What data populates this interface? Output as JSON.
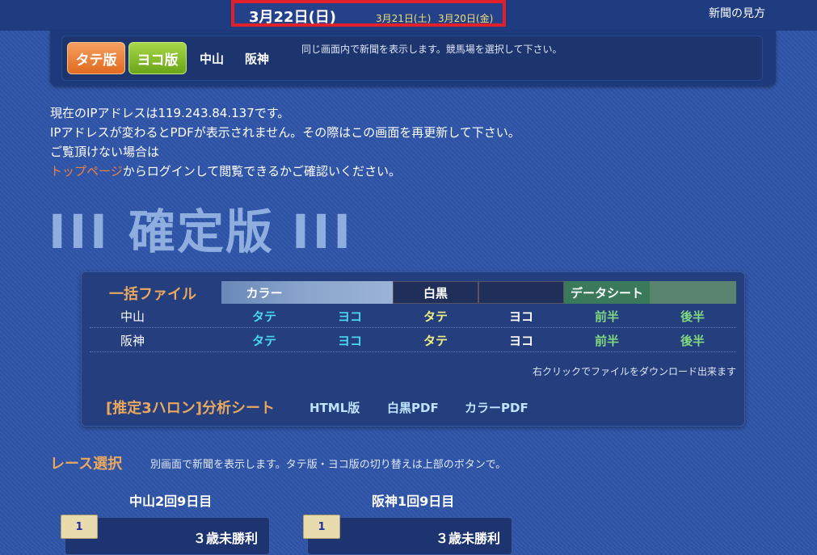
{
  "header": {
    "date_main": "3月22日(日)",
    "date_sat": "3月21日(土)",
    "date_fri": "3月20日(金)",
    "guide_link": "新聞の見方"
  },
  "panel": {
    "tate_button": "タテ版",
    "yoko_button": "ヨコ版",
    "course_nakayama": "中山",
    "course_hanshin": "阪神",
    "note": "同じ画面内で新聞を表示します。競馬場を選択して下さい。"
  },
  "messages": {
    "line1": "現在のIPアドレスは119.243.84.137です。",
    "line2": "IPアドレスが変わるとPDFが表示されません。その際はこの画面を再更新して下さい。",
    "line3": "ご覧頂けない場合は",
    "line4_link": "トップページ",
    "line4_rest": "からログインして閲覧できるかご確認いください。"
  },
  "title": {
    "bars": "III",
    "label": "確定版"
  },
  "bulk": {
    "title": "一括ファイル",
    "h_color": "カラー",
    "h_bw": "白黒",
    "h_data": "データシート",
    "rows": [
      {
        "name": "中山",
        "c1": "タテ",
        "c2": "ヨコ",
        "c3": "タテ",
        "c4": "ヨコ",
        "c5": "前半",
        "c6": "後半"
      },
      {
        "name": "阪神",
        "c1": "タテ",
        "c2": "ヨコ",
        "c3": "タテ",
        "c4": "ヨコ",
        "c5": "前半",
        "c6": "後半"
      }
    ],
    "rclick_note": "右クリックでファイルをダウンロード出来ます",
    "analysis_title": "[推定3ハロン]分析シート",
    "html_link": "HTML版",
    "bw_pdf": "白黒PDF",
    "color_pdf": "カラーPDF"
  },
  "race": {
    "title": "レース選択",
    "note": "別画面で新聞を表示します。タテ版・ヨコ版の切り替えは上部のボタンで。",
    "venues": [
      {
        "label": "中山2回9日目",
        "race_no": "1",
        "race_name": "３歳未勝利"
      },
      {
        "label": "阪神1回9日目",
        "race_no": "1",
        "race_name": "３歳未勝利"
      }
    ]
  }
}
